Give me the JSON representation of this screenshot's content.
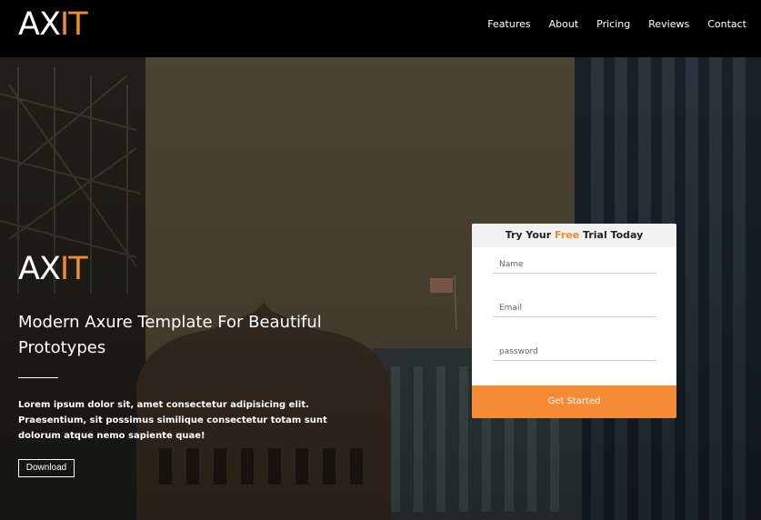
{
  "brand": {
    "prefix": "AX",
    "accent": "IT"
  },
  "nav": [
    {
      "label": "Features"
    },
    {
      "label": "About"
    },
    {
      "label": "Pricing"
    },
    {
      "label": "Reviews"
    },
    {
      "label": "Contact"
    }
  ],
  "hero": {
    "title_prefix": "AX",
    "title_accent": "IT",
    "subtitle": "Modern Axure Template For Beautiful Prototypes",
    "body": "Lorem ipsum dolor sit, amet consectetur adipisicing elit. Praesentium, sit possimus similique consectetur totam sunt dolorum atque nemo sapiente quae!",
    "download_label": "Download"
  },
  "form": {
    "heading_before": "Try Your",
    "heading_accent": "Free",
    "heading_after": "Trial Today",
    "name_placeholder": "Name",
    "email_placeholder": "Email",
    "password_placeholder": "password",
    "submit_label": "Get Started"
  },
  "colors": {
    "accent": "#f28a2e",
    "cta": "#f68b35",
    "header_bg": "#000000"
  }
}
